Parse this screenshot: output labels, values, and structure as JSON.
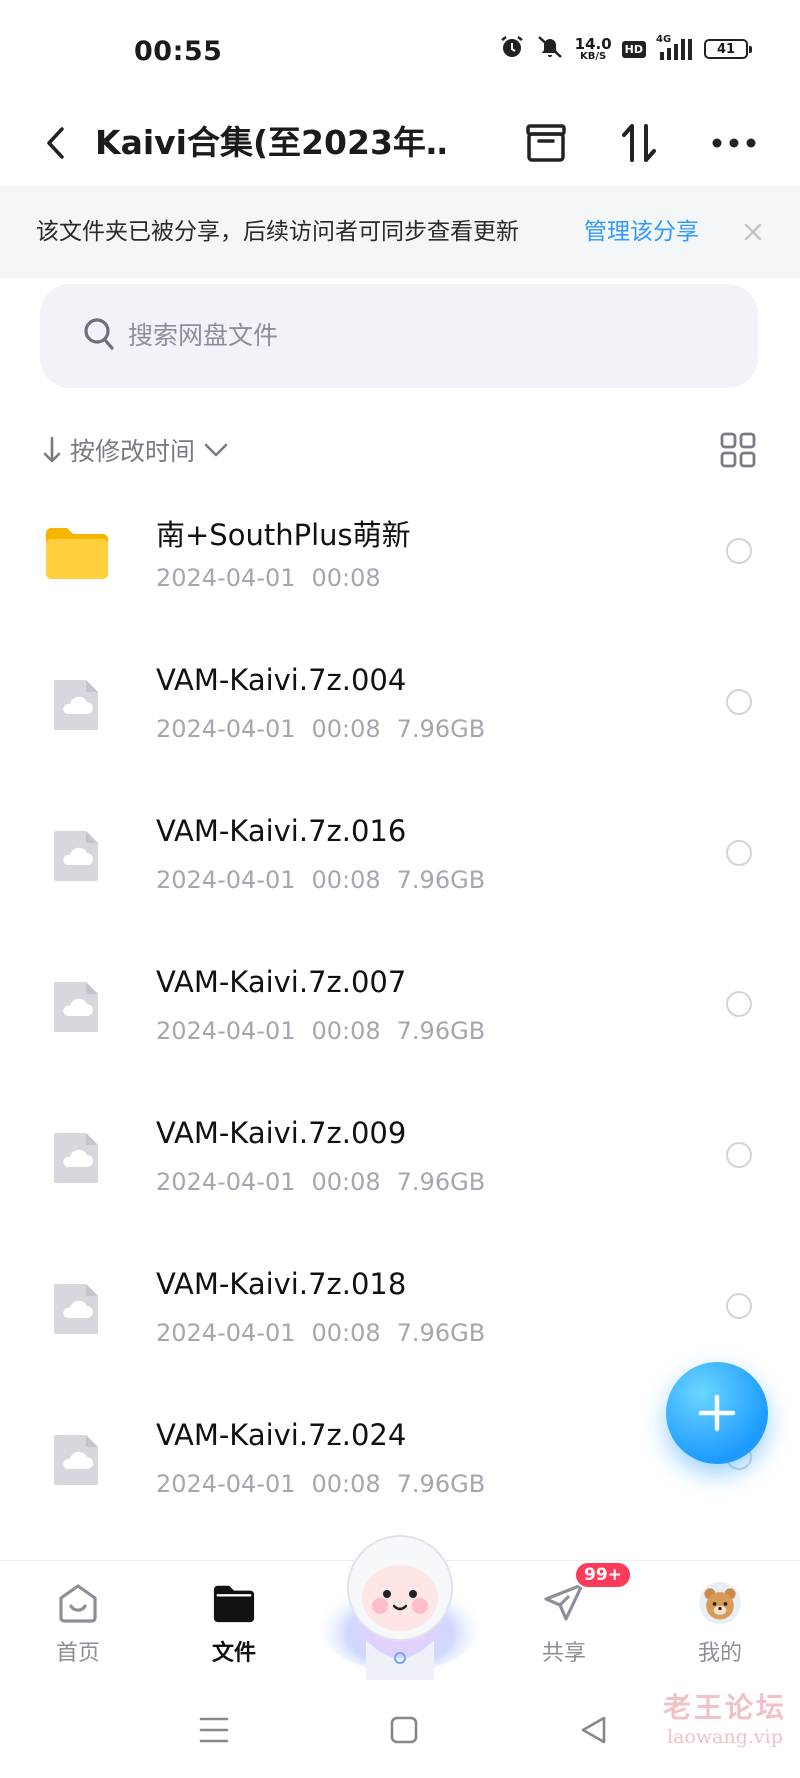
{
  "status_bar": {
    "time": "00:55",
    "net_speed_value": "14.0",
    "net_speed_unit": "KB/S",
    "hd_label": "HD",
    "network_type": "4G",
    "battery_level": "41"
  },
  "header": {
    "title": "Kaivi合集(至2023年…"
  },
  "share_banner": {
    "message": "该文件夹已被分享，后续访问者可同步查看更新",
    "action_label": "管理该分享"
  },
  "search": {
    "placeholder": "搜索网盘文件"
  },
  "sort": {
    "label": "按修改时间"
  },
  "files": [
    {
      "name": "南+SouthPlus萌新",
      "date": "2024-04-01",
      "time": "00:08",
      "size": "",
      "type": "folder"
    },
    {
      "name": "VAM-Kaivi.7z.004",
      "date": "2024-04-01",
      "time": "00:08",
      "size": "7.96GB",
      "type": "file"
    },
    {
      "name": "VAM-Kaivi.7z.016",
      "date": "2024-04-01",
      "time": "00:08",
      "size": "7.96GB",
      "type": "file"
    },
    {
      "name": "VAM-Kaivi.7z.007",
      "date": "2024-04-01",
      "time": "00:08",
      "size": "7.96GB",
      "type": "file"
    },
    {
      "name": "VAM-Kaivi.7z.009",
      "date": "2024-04-01",
      "time": "00:08",
      "size": "7.96GB",
      "type": "file"
    },
    {
      "name": "VAM-Kaivi.7z.018",
      "date": "2024-04-01",
      "time": "00:08",
      "size": "7.96GB",
      "type": "file"
    },
    {
      "name": "VAM-Kaivi.7z.024",
      "date": "2024-04-01",
      "time": "00:08",
      "size": "7.96GB",
      "type": "file"
    }
  ],
  "bottom_nav": {
    "items": [
      {
        "label": "首页",
        "icon": "home-icon"
      },
      {
        "label": "文件",
        "icon": "folder-icon"
      },
      {
        "label": "共享",
        "icon": "share-plane-icon",
        "badge": "99+"
      },
      {
        "label": "我的",
        "icon": "profile-avatar-icon"
      }
    ]
  },
  "watermark": {
    "title": "老王论坛",
    "subtitle": "laowang.vip"
  },
  "colors": {
    "accent": "#2f9bff",
    "badge": "#ff3b5c",
    "folder": "#ffc933",
    "meta_text": "#a4a7b0"
  }
}
